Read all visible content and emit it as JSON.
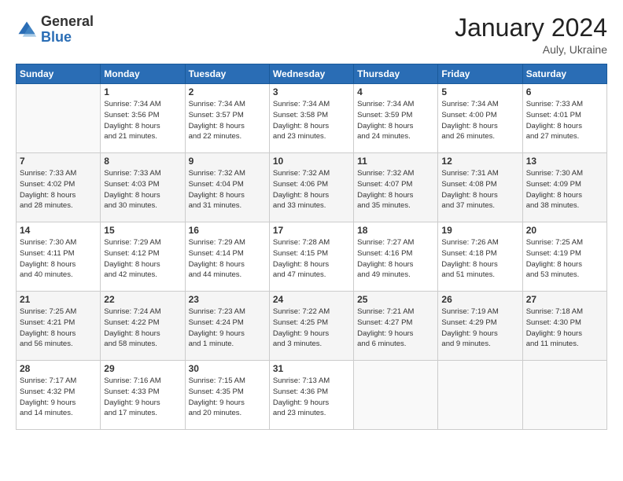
{
  "header": {
    "logo_general": "General",
    "logo_blue": "Blue",
    "month_title": "January 2024",
    "location": "Auly, Ukraine"
  },
  "columns": [
    "Sunday",
    "Monday",
    "Tuesday",
    "Wednesday",
    "Thursday",
    "Friday",
    "Saturday"
  ],
  "weeks": [
    [
      {
        "day": "",
        "info": ""
      },
      {
        "day": "1",
        "info": "Sunrise: 7:34 AM\nSunset: 3:56 PM\nDaylight: 8 hours\nand 21 minutes."
      },
      {
        "day": "2",
        "info": "Sunrise: 7:34 AM\nSunset: 3:57 PM\nDaylight: 8 hours\nand 22 minutes."
      },
      {
        "day": "3",
        "info": "Sunrise: 7:34 AM\nSunset: 3:58 PM\nDaylight: 8 hours\nand 23 minutes."
      },
      {
        "day": "4",
        "info": "Sunrise: 7:34 AM\nSunset: 3:59 PM\nDaylight: 8 hours\nand 24 minutes."
      },
      {
        "day": "5",
        "info": "Sunrise: 7:34 AM\nSunset: 4:00 PM\nDaylight: 8 hours\nand 26 minutes."
      },
      {
        "day": "6",
        "info": "Sunrise: 7:33 AM\nSunset: 4:01 PM\nDaylight: 8 hours\nand 27 minutes."
      }
    ],
    [
      {
        "day": "7",
        "info": "Sunrise: 7:33 AM\nSunset: 4:02 PM\nDaylight: 8 hours\nand 28 minutes."
      },
      {
        "day": "8",
        "info": "Sunrise: 7:33 AM\nSunset: 4:03 PM\nDaylight: 8 hours\nand 30 minutes."
      },
      {
        "day": "9",
        "info": "Sunrise: 7:32 AM\nSunset: 4:04 PM\nDaylight: 8 hours\nand 31 minutes."
      },
      {
        "day": "10",
        "info": "Sunrise: 7:32 AM\nSunset: 4:06 PM\nDaylight: 8 hours\nand 33 minutes."
      },
      {
        "day": "11",
        "info": "Sunrise: 7:32 AM\nSunset: 4:07 PM\nDaylight: 8 hours\nand 35 minutes."
      },
      {
        "day": "12",
        "info": "Sunrise: 7:31 AM\nSunset: 4:08 PM\nDaylight: 8 hours\nand 37 minutes."
      },
      {
        "day": "13",
        "info": "Sunrise: 7:30 AM\nSunset: 4:09 PM\nDaylight: 8 hours\nand 38 minutes."
      }
    ],
    [
      {
        "day": "14",
        "info": "Sunrise: 7:30 AM\nSunset: 4:11 PM\nDaylight: 8 hours\nand 40 minutes."
      },
      {
        "day": "15",
        "info": "Sunrise: 7:29 AM\nSunset: 4:12 PM\nDaylight: 8 hours\nand 42 minutes."
      },
      {
        "day": "16",
        "info": "Sunrise: 7:29 AM\nSunset: 4:14 PM\nDaylight: 8 hours\nand 44 minutes."
      },
      {
        "day": "17",
        "info": "Sunrise: 7:28 AM\nSunset: 4:15 PM\nDaylight: 8 hours\nand 47 minutes."
      },
      {
        "day": "18",
        "info": "Sunrise: 7:27 AM\nSunset: 4:16 PM\nDaylight: 8 hours\nand 49 minutes."
      },
      {
        "day": "19",
        "info": "Sunrise: 7:26 AM\nSunset: 4:18 PM\nDaylight: 8 hours\nand 51 minutes."
      },
      {
        "day": "20",
        "info": "Sunrise: 7:25 AM\nSunset: 4:19 PM\nDaylight: 8 hours\nand 53 minutes."
      }
    ],
    [
      {
        "day": "21",
        "info": "Sunrise: 7:25 AM\nSunset: 4:21 PM\nDaylight: 8 hours\nand 56 minutes."
      },
      {
        "day": "22",
        "info": "Sunrise: 7:24 AM\nSunset: 4:22 PM\nDaylight: 8 hours\nand 58 minutes."
      },
      {
        "day": "23",
        "info": "Sunrise: 7:23 AM\nSunset: 4:24 PM\nDaylight: 9 hours\nand 1 minute."
      },
      {
        "day": "24",
        "info": "Sunrise: 7:22 AM\nSunset: 4:25 PM\nDaylight: 9 hours\nand 3 minutes."
      },
      {
        "day": "25",
        "info": "Sunrise: 7:21 AM\nSunset: 4:27 PM\nDaylight: 9 hours\nand 6 minutes."
      },
      {
        "day": "26",
        "info": "Sunrise: 7:19 AM\nSunset: 4:29 PM\nDaylight: 9 hours\nand 9 minutes."
      },
      {
        "day": "27",
        "info": "Sunrise: 7:18 AM\nSunset: 4:30 PM\nDaylight: 9 hours\nand 11 minutes."
      }
    ],
    [
      {
        "day": "28",
        "info": "Sunrise: 7:17 AM\nSunset: 4:32 PM\nDaylight: 9 hours\nand 14 minutes."
      },
      {
        "day": "29",
        "info": "Sunrise: 7:16 AM\nSunset: 4:33 PM\nDaylight: 9 hours\nand 17 minutes."
      },
      {
        "day": "30",
        "info": "Sunrise: 7:15 AM\nSunset: 4:35 PM\nDaylight: 9 hours\nand 20 minutes."
      },
      {
        "day": "31",
        "info": "Sunrise: 7:13 AM\nSunset: 4:36 PM\nDaylight: 9 hours\nand 23 minutes."
      },
      {
        "day": "",
        "info": ""
      },
      {
        "day": "",
        "info": ""
      },
      {
        "day": "",
        "info": ""
      }
    ]
  ]
}
